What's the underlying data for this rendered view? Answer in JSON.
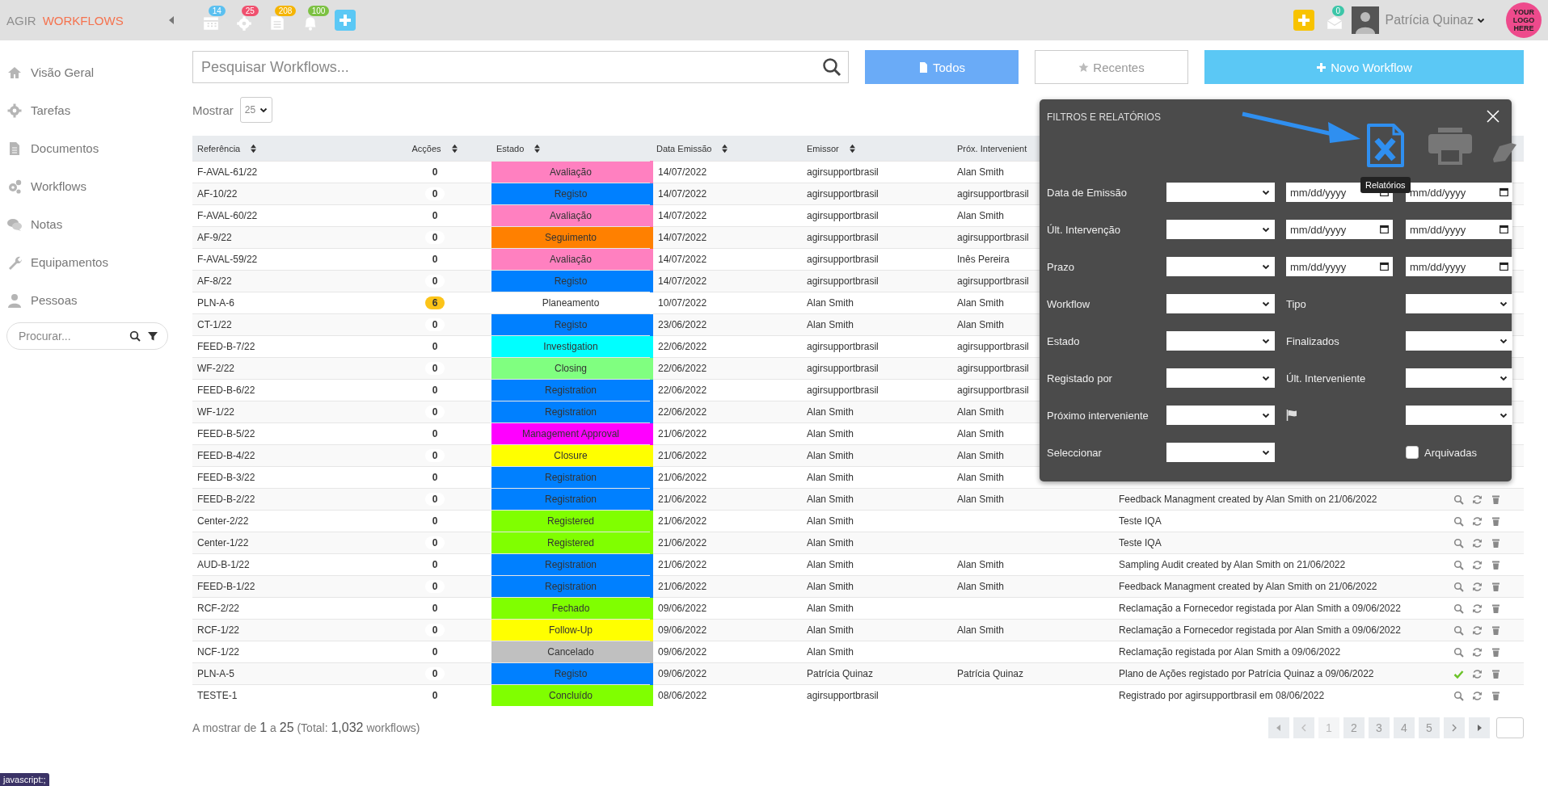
{
  "topbar": {
    "brand": "AGIR",
    "module": "WORKFLOWS",
    "badges": [
      {
        "kind": "calendar",
        "count": "14",
        "color": "#5bc0f0"
      },
      {
        "kind": "gear",
        "count": "25",
        "color": "#f0506e"
      },
      {
        "kind": "document",
        "count": "208",
        "color": "#f5b400"
      },
      {
        "kind": "bell",
        "count": "100",
        "color": "#7cc142"
      }
    ],
    "mail_count": "0",
    "user": "Patrícia Quinaz",
    "logo_lines": [
      "YOUR",
      "LOGO",
      "HERE"
    ]
  },
  "sidebar": {
    "items": [
      {
        "kind": "home",
        "label": "Visão Geral"
      },
      {
        "kind": "gear",
        "label": "Tarefas"
      },
      {
        "kind": "document",
        "label": "Documentos"
      },
      {
        "kind": "gears",
        "label": "Workflows"
      },
      {
        "kind": "chat",
        "label": "Notas"
      },
      {
        "kind": "wrench",
        "label": "Equipamentos"
      },
      {
        "kind": "person",
        "label": "Pessoas"
      }
    ],
    "search_placeholder": "Procurar..."
  },
  "search": {
    "placeholder": "Pesquisar Workflows..."
  },
  "buttons": [
    {
      "kind": "todos",
      "label": "Todos",
      "selected": true
    },
    {
      "kind": "recentes",
      "label": "Recentes",
      "selected": false
    },
    {
      "kind": "new",
      "label": "Novo Workflow"
    }
  ],
  "page_size": {
    "label": "Mostrar",
    "value": "25"
  },
  "table": {
    "columns": [
      {
        "label": "Referência",
        "sortable": true
      },
      {
        "label": "Acções",
        "sortable": true
      },
      {
        "label": "Estado",
        "sortable": true
      },
      {
        "label": "Data Emissão",
        "sortable": true
      },
      {
        "label": "Emissor",
        "sortable": true
      },
      {
        "label": "Próx. Intervenient",
        "sortable": false
      }
    ],
    "rows": [
      {
        "ref": "F-AVAL-61/22",
        "actions": "0",
        "highlight": false,
        "state": "Avaliação",
        "color": "#ff80c0",
        "date": "14/07/2022",
        "emissor": "agirsupportbrasil",
        "next": "Alan Smith"
      },
      {
        "ref": "AF-10/22",
        "actions": "0",
        "highlight": false,
        "state": "Registo",
        "color": "#0080ff",
        "date": "14/07/2022",
        "emissor": "agirsupportbrasil",
        "next": "agirsupportbrasil"
      },
      {
        "ref": "F-AVAL-60/22",
        "actions": "0",
        "highlight": false,
        "state": "Avaliação",
        "color": "#ff80c0",
        "date": "14/07/2022",
        "emissor": "agirsupportbrasil",
        "next": "Alan Smith"
      },
      {
        "ref": "AF-9/22",
        "actions": "0",
        "highlight": false,
        "state": "Seguimento",
        "color": "#ff8000",
        "date": "14/07/2022",
        "emissor": "agirsupportbrasil",
        "next": "agirsupportbrasil"
      },
      {
        "ref": "F-AVAL-59/22",
        "actions": "0",
        "highlight": false,
        "state": "Avaliação",
        "color": "#ff80c0",
        "date": "14/07/2022",
        "emissor": "agirsupportbrasil",
        "next": "Inês Pereira"
      },
      {
        "ref": "AF-8/22",
        "actions": "0",
        "highlight": false,
        "state": "Registo",
        "color": "#0080ff",
        "date": "14/07/2022",
        "emissor": "agirsupportbrasil",
        "next": "agirsupportbrasil"
      },
      {
        "ref": "PLN-A-6",
        "actions": "6",
        "highlight": true,
        "state": "Planeamento",
        "date": "10/07/2022",
        "emissor": "Alan Smith",
        "next": "Alan Smith"
      },
      {
        "ref": "CT-1/22",
        "actions": "0",
        "highlight": false,
        "state": "Registo",
        "color": "#0080ff",
        "date": "23/06/2022",
        "emissor": "Alan Smith",
        "next": "Alan Smith"
      },
      {
        "ref": "FEED-B-7/22",
        "actions": "0",
        "highlight": false,
        "state": "Investigation",
        "color": "#00ffff",
        "date": "22/06/2022",
        "emissor": "agirsupportbrasil",
        "next": "agirsupportbrasil"
      },
      {
        "ref": "WF-2/22",
        "actions": "0",
        "highlight": false,
        "state": "Closing",
        "color": "#80ff80",
        "date": "22/06/2022",
        "emissor": "agirsupportbrasil",
        "next": "agirsupportbrasil"
      },
      {
        "ref": "FEED-B-6/22",
        "actions": "0",
        "highlight": false,
        "state": "Registration",
        "color": "#0080ff",
        "date": "22/06/2022",
        "emissor": "agirsupportbrasil",
        "next": "agirsupportbrasil"
      },
      {
        "ref": "WF-1/22",
        "actions": "0",
        "highlight": false,
        "state": "Registration",
        "color": "#0080ff",
        "date": "22/06/2022",
        "emissor": "Alan Smith",
        "next": "Alan Smith"
      },
      {
        "ref": "FEED-B-5/22",
        "actions": "0",
        "highlight": false,
        "state": "Management Approval",
        "color": "#ff00ff",
        "date": "21/06/2022",
        "emissor": "Alan Smith",
        "next": "Alan Smith"
      },
      {
        "ref": "FEED-B-4/22",
        "actions": "0",
        "highlight": false,
        "state": "Closure",
        "color": "#ffff00",
        "date": "21/06/2022",
        "emissor": "Alan Smith",
        "next": "Alan Smith"
      },
      {
        "ref": "FEED-B-3/22",
        "actions": "0",
        "highlight": false,
        "state": "Registration",
        "color": "#0080ff",
        "date": "21/06/2022",
        "emissor": "Alan Smith",
        "next": "Alan Smith"
      },
      {
        "ref": "FEED-B-2/22",
        "actions": "0",
        "highlight": false,
        "state": "Registration",
        "color": "#0080ff",
        "date": "21/06/2022",
        "emissor": "Alan Smith",
        "next": "Alan Smith",
        "title": "Feedback Managment created by Alan Smith on 21/06/2022",
        "done": false
      },
      {
        "ref": "Center-2/22",
        "actions": "0",
        "highlight": false,
        "state": "Registered",
        "color": "#80ff00",
        "date": "21/06/2022",
        "emissor": "Alan Smith",
        "title": "Teste IQA",
        "done": false
      },
      {
        "ref": "Center-1/22",
        "actions": "0",
        "highlight": false,
        "state": "Registered",
        "color": "#80ff00",
        "date": "21/06/2022",
        "emissor": "Alan Smith",
        "title": "Teste IQA",
        "done": false
      },
      {
        "ref": "AUD-B-1/22",
        "actions": "0",
        "highlight": false,
        "state": "Registration",
        "color": "#0080ff",
        "date": "21/06/2022",
        "emissor": "Alan Smith",
        "next": "Alan Smith",
        "title": "Sampling Audit created by Alan Smith on 21/06/2022",
        "done": false
      },
      {
        "ref": "FEED-B-1/22",
        "actions": "0",
        "highlight": false,
        "state": "Registration",
        "color": "#0080ff",
        "date": "21/06/2022",
        "emissor": "Alan Smith",
        "next": "Alan Smith",
        "title": "Feedback Managment created by Alan Smith on 21/06/2022",
        "done": false
      },
      {
        "ref": "RCF-2/22",
        "actions": "0",
        "highlight": false,
        "state": "Fechado",
        "color": "#80ff00",
        "date": "09/06/2022",
        "emissor": "Alan Smith",
        "title": "Reclamação a Fornecedor registada por Alan Smith a 09/06/2022",
        "done": false
      },
      {
        "ref": "RCF-1/22",
        "actions": "0",
        "highlight": false,
        "state": "Follow-Up",
        "color": "#ffff00",
        "date": "09/06/2022",
        "emissor": "Alan Smith",
        "next": "Alan Smith",
        "title": "Reclamação a Fornecedor registada por Alan Smith a 09/06/2022",
        "done": false
      },
      {
        "ref": "NCF-1/22",
        "actions": "0",
        "highlight": false,
        "state": "Cancelado",
        "color": "#c0c0c0",
        "date": "09/06/2022",
        "emissor": "Alan Smith",
        "title": "Reclamação registada por Alan Smith a 09/06/2022",
        "done": false
      },
      {
        "ref": "PLN-A-5",
        "actions": "0",
        "highlight": false,
        "state": "Registo",
        "color": "#0080ff",
        "date": "09/06/2022",
        "emissor": "Patrícia Quinaz",
        "next": "Patrícia Quinaz",
        "title": "Plano de Ações registado por Patrícia Quinaz a 09/06/2022",
        "done": true
      },
      {
        "ref": "TESTE-1",
        "actions": "0",
        "highlight": false,
        "state": "Concluído",
        "color": "#80ff00",
        "date": "08/06/2022",
        "emissor": "agirsupportbrasil",
        "title": "Registrado por agirsupportbrasil em 08/06/2022",
        "done": false
      }
    ]
  },
  "footer": {
    "summary": "A mostrar de **1** a **25** (Total: **1,032** workflows)",
    "pages": [
      {
        "label": "1",
        "selected": true
      },
      {
        "label": "2",
        "selected": false
      },
      {
        "label": "3",
        "selected": false
      },
      {
        "label": "4",
        "selected": false
      },
      {
        "label": "5",
        "selected": false
      }
    ]
  },
  "filter_panel": {
    "title": "FILTROS E RELATÓRIOS",
    "tooltip": "Relatórios",
    "rows": [
      {
        "kind": "date_range",
        "label": "Data de Emissão",
        "placeholders": [
          "mm/dd/yyyy",
          "mm/dd/yyyy"
        ]
      },
      {
        "kind": "date_range",
        "label": "Últ. Intervenção",
        "placeholders": [
          "mm/dd/yyyy",
          "mm/dd/yyyy"
        ]
      },
      {
        "kind": "date_range",
        "label": "Prazo",
        "placeholders": [
          "mm/dd/yyyy",
          "mm/dd/yyyy"
        ]
      },
      {
        "kind": "pair",
        "label": "Workflow",
        "second_label": "Tipo"
      },
      {
        "kind": "pair",
        "label": "Estado",
        "second_label": "Finalizados"
      },
      {
        "kind": "pair",
        "label": "Registado por",
        "second_label": "Últ. Interveniente"
      },
      {
        "kind": "flag",
        "label": "Próximo interveniente"
      },
      {
        "kind": "check",
        "label": "Seleccionar",
        "second_label": "Arquivadas",
        "checked": false
      }
    ]
  },
  "status_bar": "javascript:;"
}
